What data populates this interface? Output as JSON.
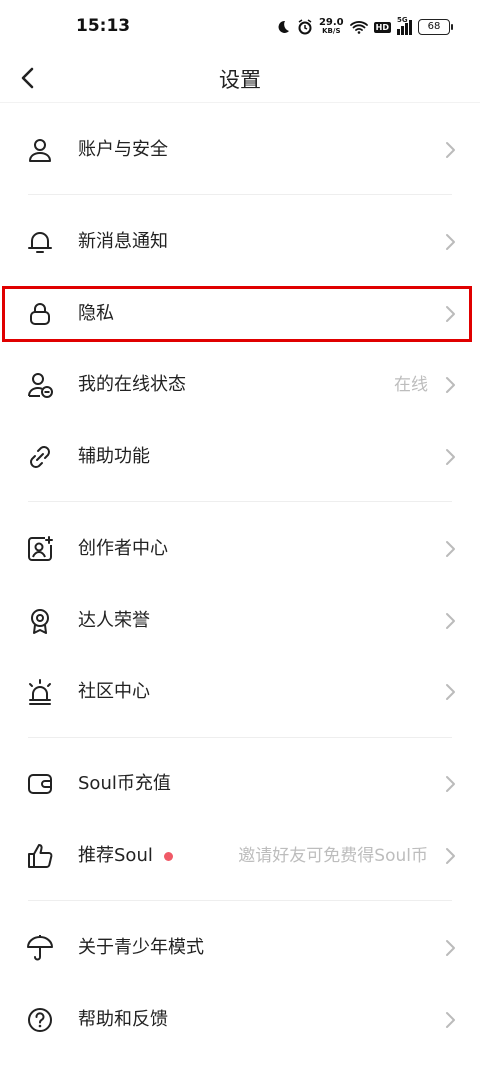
{
  "status_bar": {
    "time": "15:13",
    "net_speed": "29.0",
    "net_unit": "KB/S",
    "hd": "HD",
    "network": "5G",
    "battery": "68"
  },
  "header": {
    "title": "设置"
  },
  "rows": [
    {
      "label": "账户与安全",
      "icon": "user-icon"
    },
    {
      "label": "新消息通知",
      "icon": "bell-icon"
    },
    {
      "label": "隐私",
      "icon": "lock-icon"
    },
    {
      "label": "我的在线状态",
      "value": "在线",
      "icon": "user-status-icon"
    },
    {
      "label": "辅助功能",
      "icon": "link-icon"
    },
    {
      "label": "创作者中心",
      "icon": "creator-icon"
    },
    {
      "label": "达人荣誉",
      "icon": "award-icon"
    },
    {
      "label": "社区中心",
      "icon": "alarm-icon"
    },
    {
      "label": "Soul币充值",
      "icon": "wallet-icon"
    },
    {
      "label": "推荐Soul",
      "value": "邀请好友可免费得Soul币",
      "icon": "thumbs-up-icon"
    },
    {
      "label": "关于青少年模式",
      "icon": "umbrella-icon"
    },
    {
      "label": "帮助和反馈",
      "icon": "help-icon"
    }
  ],
  "colors": {
    "accent_dot": "#f05a67",
    "highlight": "#e00000",
    "secondary_text": "#bdbdbd"
  }
}
